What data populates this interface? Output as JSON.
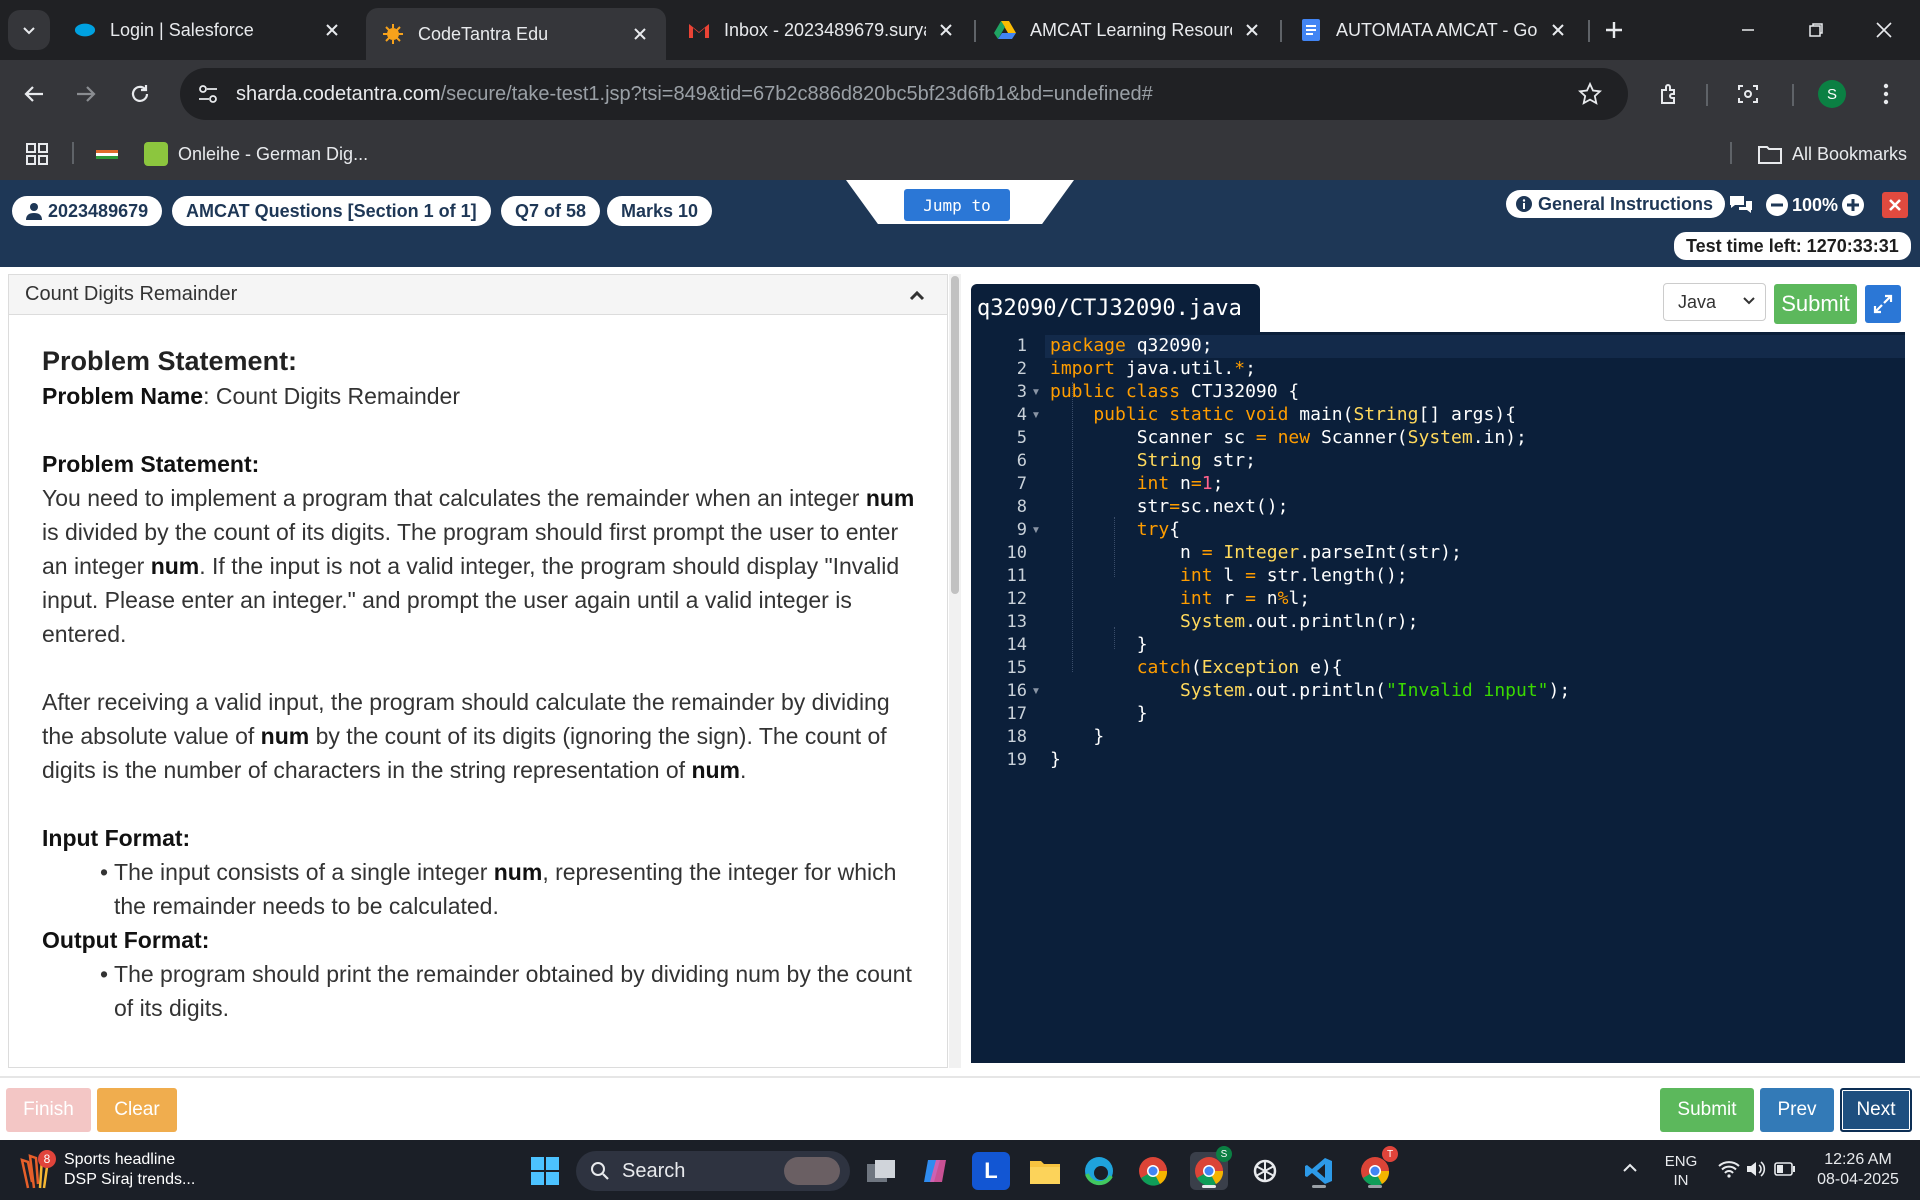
{
  "browser": {
    "tabs": [
      {
        "title": "Login | Salesforce",
        "icon": "salesforce-icon"
      },
      {
        "title": "CodeTantra Edu",
        "icon": "codetantra-icon"
      },
      {
        "title": "Inbox - 2023489679.suryan",
        "icon": "gmail-icon"
      },
      {
        "title": "AMCAT Learning Resource",
        "icon": "drive-icon"
      },
      {
        "title": "AUTOMATA AMCAT - Goog",
        "icon": "docs-icon"
      }
    ],
    "url_host": "sharda.codetantra.com",
    "url_path": "/secure/take-test1.jsp?tsi=849&tid=67b2c886d820bc5bf23d6fb1&bd=undefined#",
    "profile_initial": "S",
    "bookmarks": {
      "item": "Onleihe - German Dig...",
      "all": "All Bookmarks"
    }
  },
  "header": {
    "user_id": "2023489679",
    "section": "AMCAT Questions [Section 1 of 1]",
    "question": "Q7 of 58",
    "marks": "Marks 10",
    "jump_label": "Jump to",
    "instructions": "General Instructions",
    "zoom": "100%",
    "timer": "Test time left: 1270:33:31"
  },
  "problem": {
    "panel_title": "Count Digits Remainder",
    "heading": "Problem Statement:",
    "name_label": "Problem Name",
    "name_value": ": Count Digits Remainder",
    "statement_heading": "Problem Statement:",
    "p1": {
      "a": "You need to implement a program that calculates the remainder when an integer ",
      "b": "num",
      "c": " is divided by the count of its digits. The program should first prompt the user to enter an integer ",
      "d": "num",
      "e": ". If the input is not a valid integer, the program should display \"Invalid input. Please enter an integer.\" and prompt the user again until a valid integer is entered."
    },
    "p2": {
      "a": "After receiving a valid input, the program should calculate the remainder by dividing the absolute value of ",
      "b": "num",
      "c": " by the count of its digits (ignoring the sign). The count of digits is the number of characters in the string representation of ",
      "d": "num",
      "e": "."
    },
    "input_heading": "Input Format:",
    "input_item": {
      "a": "The input consists of a single integer ",
      "b": "num",
      "c": ", representing the integer for which the remainder needs to be calculated."
    },
    "output_heading": "Output Format:",
    "output_item": "The program should print the remainder obtained by dividing num by the count of its digits."
  },
  "editor": {
    "file_name": "q32090/CTJ32090.java",
    "language": "Java",
    "submit_label": "Submit",
    "line_numbers": [
      "1",
      "2",
      "3",
      "4",
      "5",
      "6",
      "7",
      "8",
      "9",
      "10",
      "11",
      "12",
      "13",
      "14",
      "15",
      "16",
      "17",
      "18",
      "19"
    ],
    "code": {
      "l1a": "package",
      "l1b": " q32090;",
      "l2a": "import",
      "l2b": " java.util.",
      "l2c": "*",
      "l2d": ";",
      "l3a": "public class",
      "l3b": " CTJ32090 {",
      "l4a": "    public static void",
      "l4b": " main(",
      "l4c": "String",
      "l4d": "[] args){",
      "l5a": "        Scanner sc ",
      "l5b": "=",
      "l5c": " new",
      "l5d": " Scanner(",
      "l5e": "System",
      "l5f": ".in);",
      "l6a": "        String",
      "l6b": " str;",
      "l7a": "        int",
      "l7b": " n",
      "l7c": "=",
      "l7d": "1",
      "l7e": ";",
      "l8a": "        str",
      "l8b": "=",
      "l8c": "sc.next();",
      "l9a": "        try",
      "l9b": "{",
      "l10a": "            n ",
      "l10b": "=",
      "l10c": " Integer",
      "l10d": ".parseInt(str);",
      "l11a": "            int",
      "l11b": " l ",
      "l11c": "=",
      "l11d": " str.length();",
      "l12a": "            int",
      "l12b": " r ",
      "l12c": "=",
      "l12d": " n",
      "l12e": "%",
      "l12f": "l;",
      "l13a": "            System",
      "l13b": ".out.println(r);",
      "l14a": "        }",
      "l15a": "        catch",
      "l15b": "(",
      "l15c": "Exception",
      "l15d": " e){",
      "l16a": "            System",
      "l16b": ".out.println(",
      "l16c": "\"Invalid input\"",
      "l16d": ");",
      "l17a": "        }",
      "l18a": "    }",
      "l19a": "}"
    }
  },
  "footer": {
    "finish": "Finish",
    "clear": "Clear",
    "submit": "Submit",
    "prev": "Prev",
    "next": "Next"
  },
  "taskbar": {
    "widget_badge": "8",
    "widget_title": "Sports headline",
    "widget_sub": "DSP Siraj trends...",
    "search": "Search",
    "lang_top": "ENG",
    "lang_bottom": "IN",
    "time": "12:26 AM",
    "date": "08-04-2025",
    "chrome_badge_s": "S",
    "chrome_badge_t": "T",
    "l_app": "L"
  },
  "colors": {
    "header_bg": "#1e3756",
    "editor_bg": "#0b1f3a",
    "submit_green": "#5cb85c",
    "clear_orange": "#f0ad4e",
    "nav_blue": "#337ab7"
  }
}
